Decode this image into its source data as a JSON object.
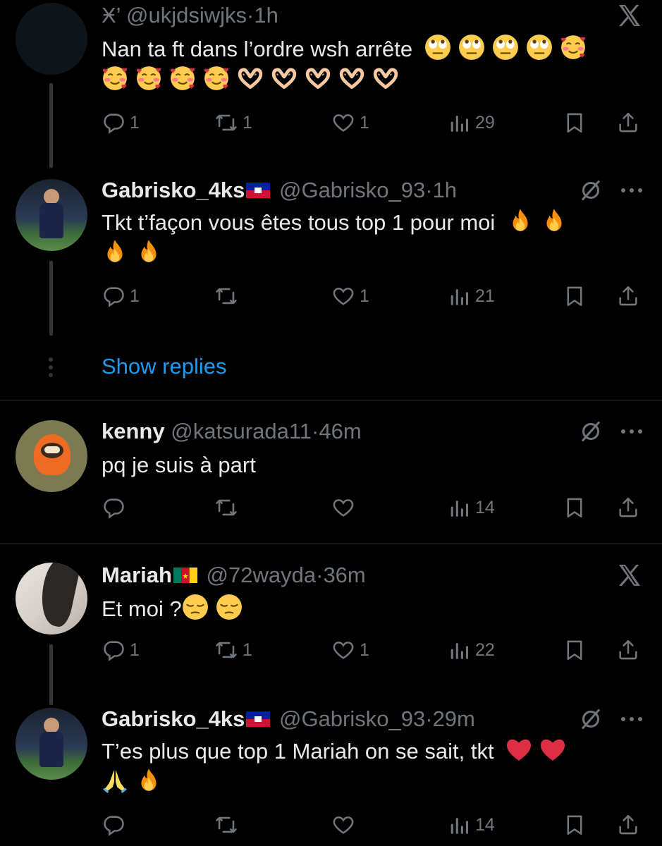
{
  "tweets": [
    {
      "id": "t1",
      "name": "Ӿ’",
      "handle": "@ukjdsiwjks",
      "dot": "·",
      "time": "1h",
      "text": "Nan ta ft dans l’ordre wsh arrête",
      "emojis_line1": [
        "rolling-eyes",
        "rolling-eyes",
        "rolling-eyes",
        "rolling-eyes",
        "smiling-hearts"
      ],
      "emojis_line2": [
        "smiling-hearts",
        "smiling-hearts",
        "smiling-hearts",
        "smiling-hearts",
        "heart-hands",
        "heart-hands",
        "heart-hands",
        "heart-hands",
        "heart-hands"
      ],
      "replies": "1",
      "reposts": "1",
      "likes": "1",
      "views": "29",
      "badge": "x-icon"
    },
    {
      "id": "t2",
      "name": "Gabrisko_4ks",
      "flag": "haiti",
      "handle": "@Gabrisko_93",
      "dot": "·",
      "time": "1h",
      "text": "Tkt t’façon vous êtes tous top 1 pour moi",
      "emojis_line1": [
        "fire",
        "fire"
      ],
      "emojis_line2": [
        "fire",
        "fire"
      ],
      "replies": "1",
      "reposts": "",
      "likes": "1",
      "views": "21",
      "badge": "grok-icon"
    },
    {
      "id": "t3",
      "name": "kenny",
      "handle": "@katsurada11",
      "dot": "·",
      "time": "46m",
      "text": "pq je suis à part",
      "replies": "",
      "reposts": "",
      "likes": "",
      "views": "14",
      "badge": "grok-icon"
    },
    {
      "id": "t4",
      "name": "Mariah",
      "flag": "cameroon",
      "handle": "@72wayda",
      "dot": "·",
      "time": "36m",
      "text": "Et moi ?",
      "emojis_line1": [
        "pensive",
        "pensive"
      ],
      "replies": "1",
      "reposts": "1",
      "likes": "1",
      "views": "22",
      "badge": "x-icon"
    },
    {
      "id": "t5",
      "name": "Gabrisko_4ks",
      "flag": "haiti",
      "handle": "@Gabrisko_93",
      "dot": "·",
      "time": "29m",
      "text": "T’es plus que top 1 Mariah on se sait, tkt",
      "emojis_line1": [
        "red-heart",
        "red-heart"
      ],
      "emojis_line2": [
        "folded-hands",
        "fire"
      ],
      "replies": "",
      "reposts": "",
      "likes": "",
      "views": "14",
      "badge": "grok-icon"
    }
  ],
  "show_replies": "Show replies",
  "colors": {
    "background": "#000000",
    "text": "#e7e9ea",
    "muted": "#71767b",
    "link": "#1d9bf0",
    "separator": "#2f3336"
  }
}
